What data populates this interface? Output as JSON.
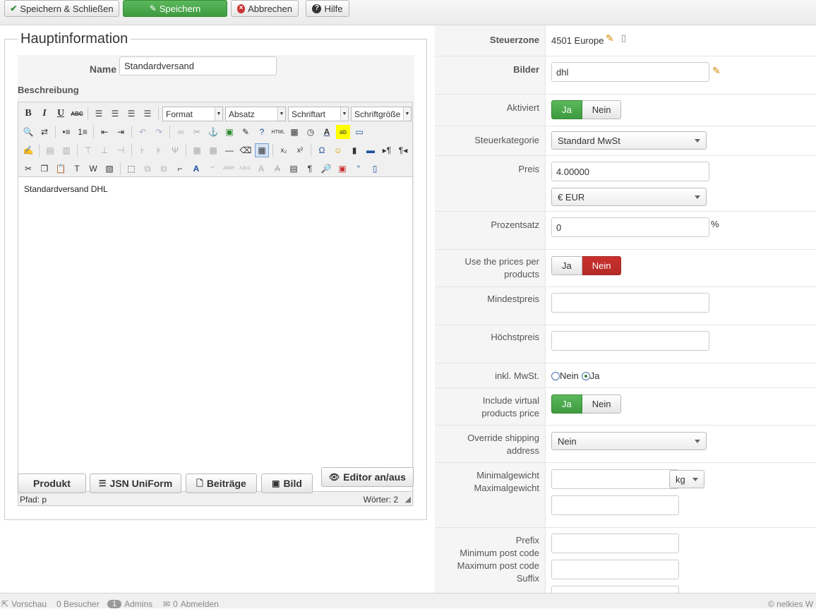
{
  "toolbar": {
    "save_close": "Speichern & Schließen",
    "save": "Speichern",
    "cancel": "Abbrechen",
    "help": "Hilfe"
  },
  "main": {
    "legend": "Hauptinformation",
    "name_label": "Name",
    "name_value": "Standardversand",
    "description_label": "Beschreibung",
    "editor": {
      "format_label": "Format",
      "paragraph_label": "Absatz",
      "font_label": "Schriftart",
      "fontsize_label": "Schriftgröße",
      "content": "Standardversand DHL",
      "path": "Pfad: p",
      "words": "Wörter: 2"
    },
    "buttons": {
      "product": "Produkt",
      "jsn": "JSN UniForm",
      "posts": "Beiträge",
      "image": "Bild",
      "editor_toggle": "Editor an/aus"
    }
  },
  "right": {
    "tax_zone_label": "Steuerzone",
    "tax_zone_value": "4501 Europe",
    "images_label": "Bilder",
    "images_value": "dhl",
    "active_label": "Aktiviert",
    "yes": "Ja",
    "no": "Nein",
    "tax_category_label": "Steuerkategorie",
    "tax_category_value": "Standard MwSt",
    "price_label": "Preis",
    "price_value": "4.00000",
    "currency_value": "€ EUR",
    "percentage_label": "Prozentsatz",
    "percentage_value": "0",
    "percent_sign": "%",
    "per_product_label_1": "Use the prices per",
    "per_product_label_2": "products",
    "min_price_label": "Mindestpreis",
    "max_price_label": "Höchstpreis",
    "incl_vat_label": "inkl. MwSt.",
    "include_virtual_label_1": "Include virtual",
    "include_virtual_label_2": "products price",
    "override_label_1": "Override shipping",
    "override_label_2": "address",
    "override_value": "Nein",
    "min_weight_label": "Minimalgewicht",
    "max_weight_label": "Maximalgewicht",
    "weight_unit": "kg",
    "prefix_label": "Prefix",
    "min_postcode_label": "Minimum post code",
    "max_postcode_label": "Maximum post code",
    "suffix_label": "Suffix"
  },
  "statusbar": {
    "preview": "Vorschau",
    "visitors": "0 Besucher",
    "admins_count": "1",
    "admins": "Admins",
    "logout_count": "0",
    "logout": "Abmelden",
    "copyright": "© nelkies W"
  },
  "colors": {
    "green": "#4cae4c",
    "red": "#c9302c",
    "label_bg": "#f5f5f5"
  }
}
